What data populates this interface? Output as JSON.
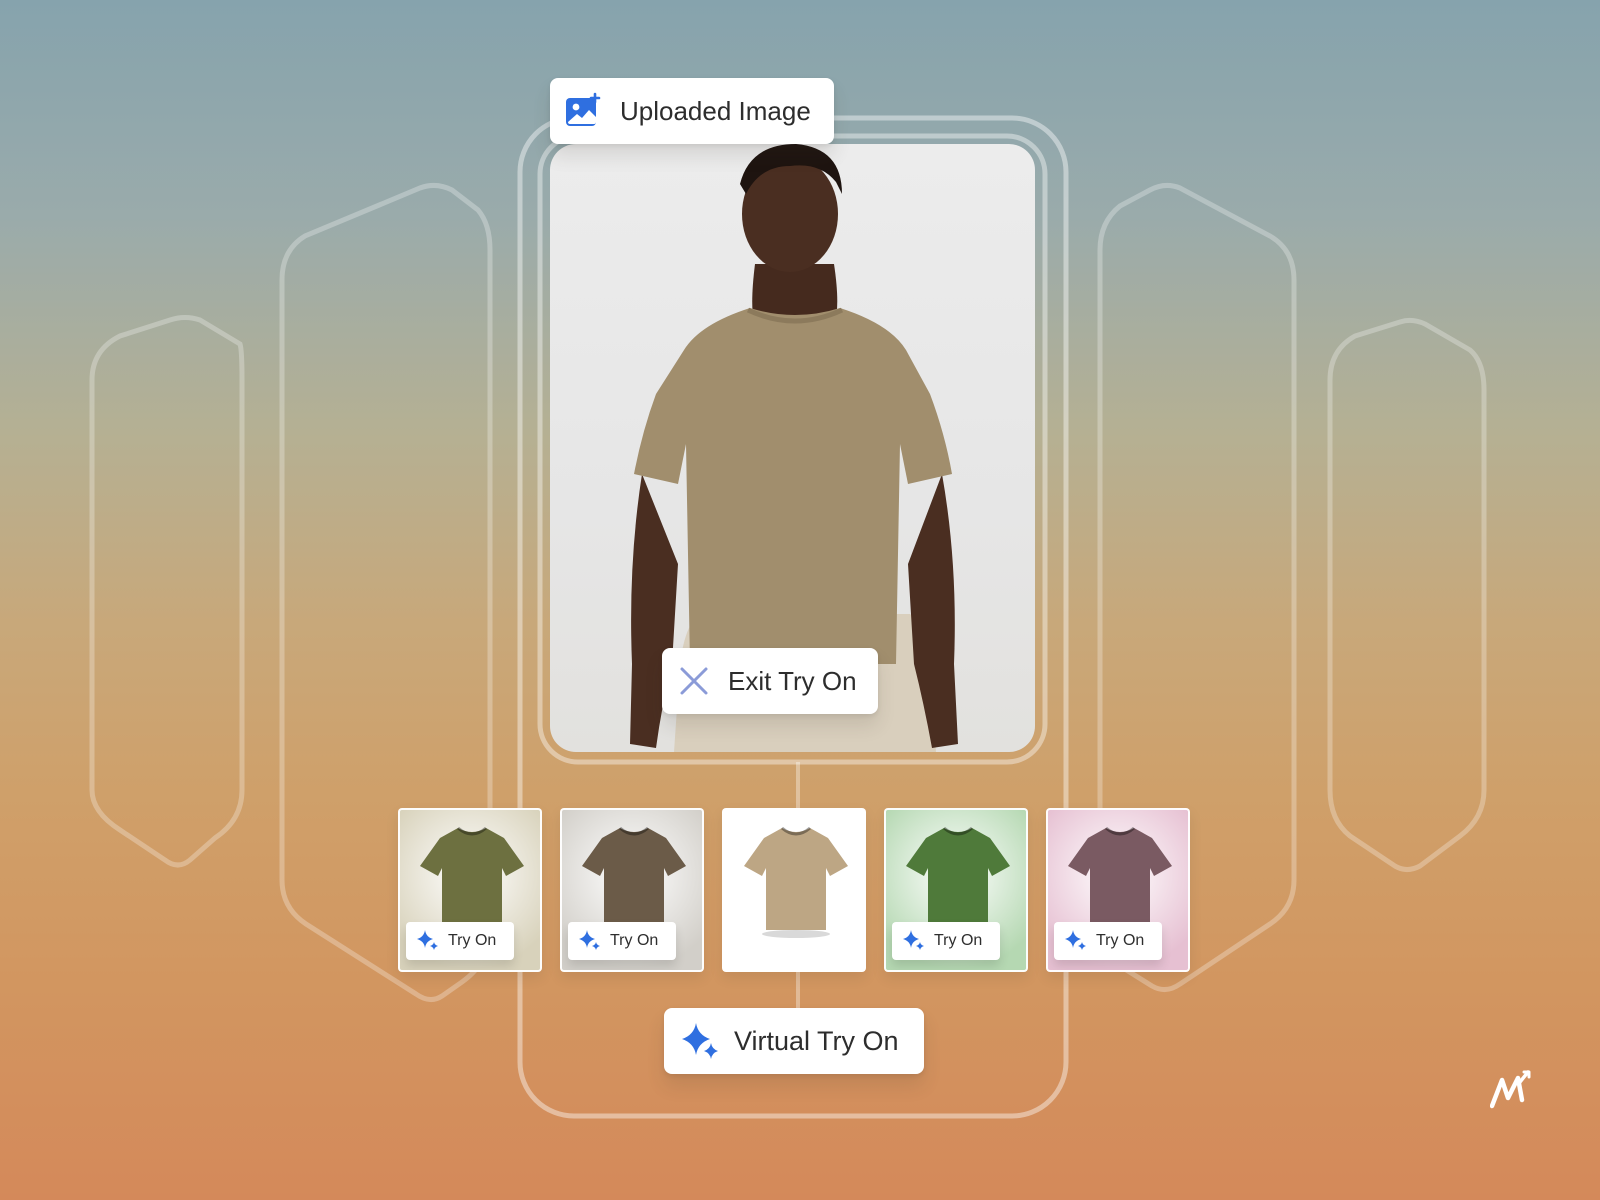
{
  "header": {
    "uploaded_label": "Uploaded Image",
    "uploaded_icon": "image-upload-icon"
  },
  "preview": {
    "exit_label": "Exit Try On",
    "exit_icon": "close-icon"
  },
  "thumbnails": [
    {
      "color": "#6d7040",
      "bg": "#d8d2bb",
      "tryon_label": "Try On",
      "has_button": true
    },
    {
      "color": "#6b5b48",
      "bg": "#d2cfc9",
      "tryon_label": "Try On",
      "has_button": true
    },
    {
      "color": "#bda684",
      "bg": "#ffffff",
      "tryon_label": "",
      "has_button": false
    },
    {
      "color": "#4f7a3a",
      "bg": "#b5d8b2",
      "tryon_label": "Try On",
      "has_button": true
    },
    {
      "color": "#7a5a62",
      "bg": "#e6c0d2",
      "tryon_label": "Try On",
      "has_button": true
    }
  ],
  "footer": {
    "virtual_label": "Virtual Try On",
    "sparkle_icon": "sparkle-icon"
  },
  "colors": {
    "accent": "#2f6fe0",
    "shirt_main": "#a18e6d",
    "skin": "#4a2e21"
  }
}
